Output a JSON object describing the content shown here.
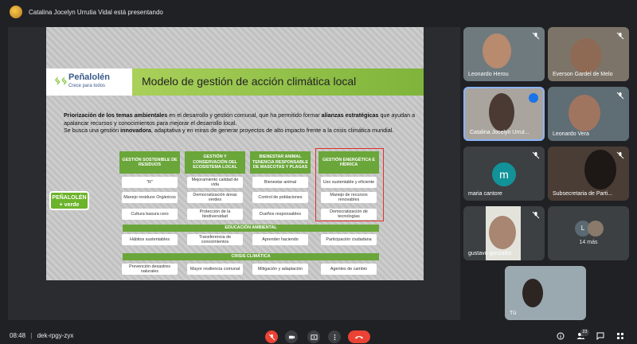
{
  "presenter": {
    "text": "Catalina Jocelyn Urrutia Vidal está presentando"
  },
  "slide": {
    "logo_name": "Peñalolén",
    "logo_tagline": "Crece para todos",
    "title": "Modelo de gestión de acción climática local",
    "paragraph": {
      "p1_bold": "Priorización de los temas ambientales",
      "p1_mid": " en el desarrollo y gestión comunal, que ha permitido formar ",
      "p1_bold2": "alianzas estratégicas",
      "p1_end": " que ayudan a apalancar recursos y conocimientos para mejorar el desarrollo local.",
      "p2_start": "Se busca una gestión ",
      "p2_bold": "innovadora",
      "p2_end": ", adaptativa y en miras de generar proyectos de alto impacto frente a la crisis climática mundial."
    },
    "badge_line1": "PEÑALOLÉN",
    "badge_line2": "+ verde",
    "categories": [
      "GESTIÓN SOSTENIBLE DE RESIDUOS",
      "GESTIÓN Y CONSERVACIÓN DEL ECOSISTEMA LOCAL",
      "BIENESTAR ANIMAL TENENCIA RESPONSABLE DE MASCOTAS Y PLAGAS",
      "GESTIÓN ENERGÉTICA E HÍDRICA"
    ],
    "column_cells": [
      [
        "\"R\"",
        "Manejo residuos Orgánicos",
        "Cultura basura cero"
      ],
      [
        "Mejoramiento calidad de vida",
        "Democratización áreas verdes",
        "Protección de la biodiversidad"
      ],
      [
        "Bienestar animal",
        "Control de poblaciones",
        "Dueños responsables"
      ],
      [
        "Uso sustentable y eficiente",
        "Manejo de recursos renovables",
        "Democratización de tecnologías"
      ]
    ],
    "band_education": "EDUCACIÓN AMBIENTAL",
    "education_cells": [
      "Hábitos sustentables",
      "Transferencia de conocimientos",
      "Aprender haciendo",
      "Participación ciudadana"
    ],
    "band_crisis": "CRISIS CLIMÁTICA",
    "crisis_cells": [
      "Prevención desastres naturales",
      "Mayor resiliencia comunal",
      "Mitigación y adaptación",
      "Agentes de cambio"
    ]
  },
  "participants": [
    {
      "name": "Leonardo Herou"
    },
    {
      "name": "Everson Gardel de Melo"
    },
    {
      "name": "Catalina Jocelyn Urrut..."
    },
    {
      "name": "Leonardo Vera"
    },
    {
      "name": "maria cantore",
      "initial": "m"
    },
    {
      "name": "Subsecretaria de Parti..."
    },
    {
      "name": "gustavo gonzalez"
    },
    {
      "name": "14 más",
      "initial": "L"
    },
    {
      "name": "Tú"
    }
  ],
  "bottom": {
    "time": "08:48",
    "separator": "|",
    "meeting_code": "dek-rpgy-zyx",
    "people_count": "23"
  },
  "colors": {
    "accent_green": "#6aa63a",
    "hangup_red": "#ea4335",
    "highlight_red": "#e0312f",
    "avatar_teal": "#12939a"
  }
}
